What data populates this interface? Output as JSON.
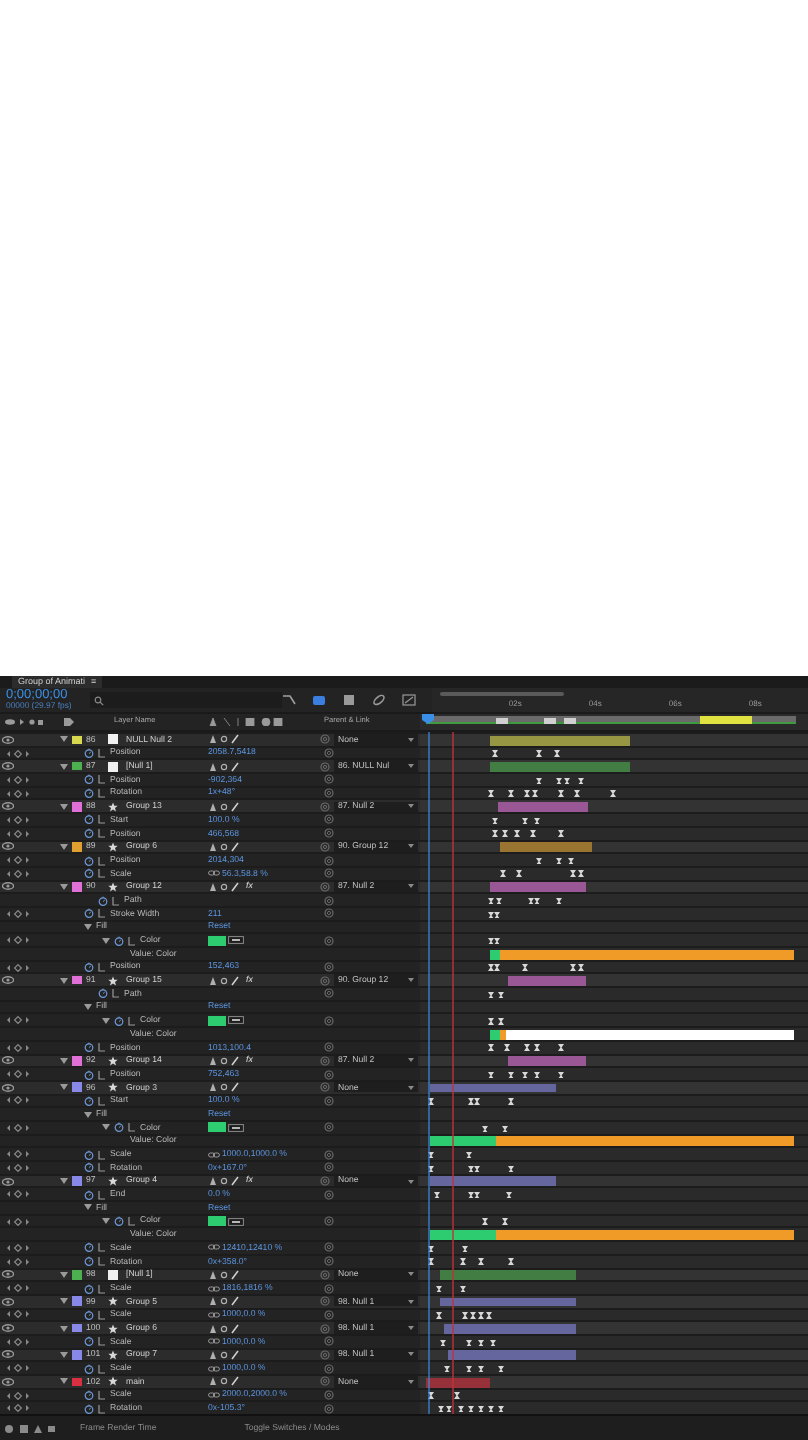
{
  "panel_tab": {
    "label": "Group of Animati",
    "menu": "≡"
  },
  "timecode": {
    "value": "0;00;00;00",
    "frames": "00000 (29.97 fps)"
  },
  "columns": {
    "layer_name": "Layer Name",
    "parent": "Parent & Link"
  },
  "ruler": {
    "labels": [
      "02s",
      "04s",
      "06s",
      "08s"
    ]
  },
  "layers": [
    {
      "number": "86",
      "name": "NULL Null 2",
      "color": "#d8d84e",
      "kind": "solid",
      "parent": "None",
      "properties": [
        {
          "kind": "property",
          "name": "Position",
          "value": "2058.7,5418"
        }
      ]
    },
    {
      "number": "87",
      "name": "[Null 1]",
      "color": "#4caf50",
      "kind": "solid",
      "parent": "86. NULL Nul",
      "properties": [
        {
          "kind": "property",
          "name": "Position",
          "value": "-902,364"
        },
        {
          "kind": "property",
          "name": "Rotation",
          "value": "1x+48°"
        }
      ]
    },
    {
      "number": "88",
      "name": "Group 13",
      "color": "#e070d8",
      "kind": "shape",
      "parent": "87. Null 2",
      "properties": [
        {
          "kind": "property",
          "name": "Start",
          "value": "100.0 %"
        },
        {
          "kind": "property",
          "name": "Position",
          "value": "466,568"
        }
      ]
    },
    {
      "number": "89",
      "name": "Group 6",
      "color": "#e0a030",
      "kind": "shape",
      "parent": "90. Group 12",
      "properties": [
        {
          "kind": "property",
          "name": "Position",
          "value": "2014,304"
        },
        {
          "kind": "property",
          "name": "Scale",
          "value": "56.3,58.8 %",
          "linked": true
        }
      ]
    },
    {
      "number": "90",
      "name": "Group 12",
      "color": "#e070d8",
      "kind": "shape",
      "fx": "fx",
      "fx_on": true,
      "parent": "87. Null 2",
      "properties": [
        {
          "kind": "path",
          "name": "Path"
        },
        {
          "kind": "property",
          "name": "Stroke Width",
          "value": "211"
        },
        {
          "kind": "group",
          "name": "Fill",
          "value": "Reset",
          "children": [
            {
              "kind": "color",
              "name": "Color",
              "color": "#2ecc71"
            },
            {
              "kind": "label",
              "name": "Value: Color"
            }
          ]
        },
        {
          "kind": "property",
          "name": "Position",
          "value": "152,463"
        }
      ]
    },
    {
      "number": "91",
      "name": "Group 15",
      "color": "#e070d8",
      "kind": "shape",
      "fx": "fx",
      "fx_on": true,
      "parent": "90. Group 12",
      "properties": [
        {
          "kind": "path",
          "name": "Path"
        },
        {
          "kind": "group",
          "name": "Fill",
          "value": "Reset",
          "children": [
            {
              "kind": "color",
              "name": "Color",
              "color": "#2ecc71"
            },
            {
              "kind": "label",
              "name": "Value: Color"
            }
          ]
        },
        {
          "kind": "property",
          "name": "Position",
          "value": "1013,100.4"
        }
      ]
    },
    {
      "number": "92",
      "name": "Group 14",
      "color": "#e070d8",
      "kind": "shape",
      "fx": "fx",
      "fx_on": true,
      "parent": "87. Null 2",
      "properties": [
        {
          "kind": "property",
          "name": "Position",
          "value": "752,463"
        }
      ]
    },
    {
      "number": "96",
      "name": "Group 3",
      "color": "#8888e8",
      "kind": "shape",
      "parent": "None",
      "properties": [
        {
          "kind": "property",
          "name": "Start",
          "value": "100.0 %"
        },
        {
          "kind": "group",
          "name": "Fill",
          "value": "Reset",
          "children": [
            {
              "kind": "color",
              "name": "Color",
              "color": "#2ecc71"
            },
            {
              "kind": "label",
              "name": "Value: Color"
            }
          ]
        },
        {
          "kind": "property",
          "name": "Scale",
          "value": "1000.0,1000.0 %",
          "linked": true
        },
        {
          "kind": "property",
          "name": "Rotation",
          "value": "0x+167.0°"
        }
      ]
    },
    {
      "number": "97",
      "name": "Group 4",
      "color": "#8888e8",
      "kind": "shape",
      "fx": "fx",
      "fx_on": true,
      "parent": "None",
      "properties": [
        {
          "kind": "property",
          "name": "End",
          "value": "0.0 %"
        },
        {
          "kind": "group",
          "name": "Fill",
          "value": "Reset",
          "children": [
            {
              "kind": "color",
              "name": "Color",
              "color": "#2ecc71"
            },
            {
              "kind": "label",
              "name": "Value: Color"
            }
          ]
        },
        {
          "kind": "property",
          "name": "Scale",
          "value": "12410,12410 %",
          "linked": true
        },
        {
          "kind": "property",
          "name": "Rotation",
          "value": "0x+358.0°"
        }
      ]
    },
    {
      "number": "98",
      "name": "[Null 1]",
      "color": "#4caf50",
      "kind": "solid",
      "parent": "None",
      "properties": [
        {
          "kind": "property",
          "name": "Scale",
          "value": "1816,1816 %",
          "linked": true
        }
      ]
    },
    {
      "number": "99",
      "name": "Group 5",
      "color": "#8888e8",
      "kind": "shape",
      "parent": "98. Null 1",
      "properties": [
        {
          "kind": "property",
          "name": "Scale",
          "value": "1000,0.0 %",
          "linked": true
        }
      ]
    },
    {
      "number": "100",
      "name": "Group 6",
      "color": "#8888e8",
      "kind": "shape",
      "parent": "98. Null 1",
      "properties": [
        {
          "kind": "property",
          "name": "Scale",
          "value": "1000,0.0 %",
          "linked": true
        }
      ]
    },
    {
      "number": "101",
      "name": "Group 7",
      "color": "#8888e8",
      "kind": "shape",
      "parent": "98. Null 1",
      "properties": [
        {
          "kind": "property",
          "name": "Scale",
          "value": "1000,0.0 %",
          "linked": true
        }
      ]
    },
    {
      "number": "102",
      "name": "main",
      "color": "#d83040",
      "kind": "shape",
      "parent": "None",
      "properties": [
        {
          "kind": "property",
          "name": "Scale",
          "value": "2000.0,2000.0 %",
          "linked": true
        },
        {
          "kind": "property",
          "name": "Rotation",
          "value": "0x-105.3°"
        }
      ]
    }
  ],
  "status_bar": {
    "left": "Frame Render Time",
    "right": "Toggle Switches / Modes"
  }
}
